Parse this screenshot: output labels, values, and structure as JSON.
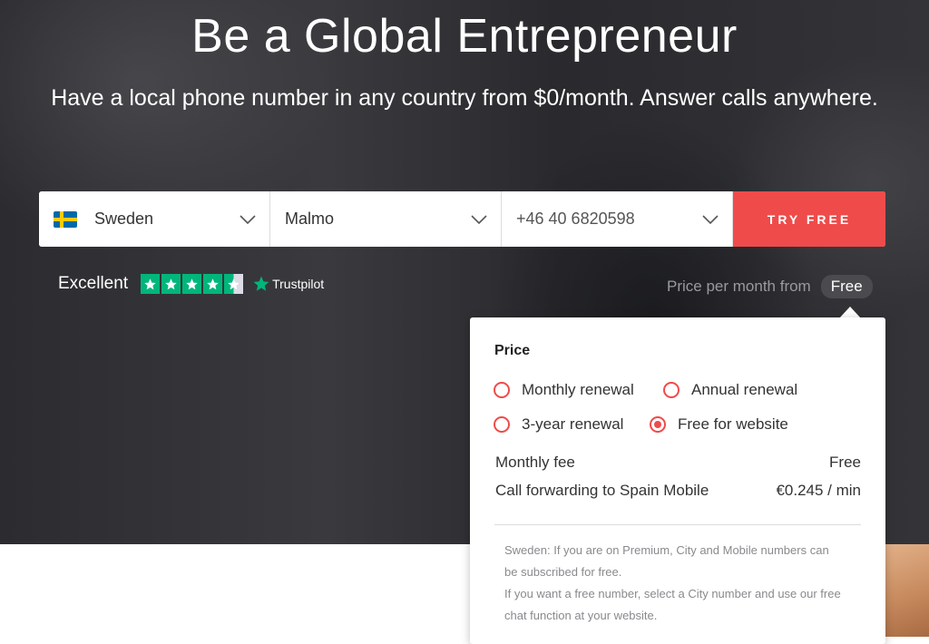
{
  "hero": {
    "title": "Be a Global Entrepreneur",
    "subtitle": "Have a local phone number in any country from $0/month. Answer calls anywhere."
  },
  "search": {
    "country": "Sweden",
    "city": "Malmo",
    "number": "+46 40 6820598",
    "button": "TRY FREE"
  },
  "colors": {
    "accent": "#ef4b4b",
    "trustpilot_green": "#00b67a",
    "hero_bg": "#2f2f33"
  },
  "rating": {
    "label": "Excellent",
    "stars": 4.5,
    "brand": "Trustpilot"
  },
  "price_summary": {
    "label": "Price per month from",
    "value": "Free"
  },
  "popup": {
    "title": "Price",
    "options": [
      {
        "label": "Monthly renewal",
        "selected": false
      },
      {
        "label": "Annual renewal",
        "selected": false
      },
      {
        "label": "3-year renewal",
        "selected": false
      },
      {
        "label": "Free for website",
        "selected": true
      }
    ],
    "fees": [
      {
        "label": "Monthly fee",
        "value": "Free"
      },
      {
        "label": "Call forwarding to Spain Mobile",
        "value": "€0.245 / min"
      }
    ],
    "note_lines": [
      "Sweden: If you are on Premium, City and Mobile numbers can",
      "be subscribed for free.",
      "If you want a free number, select a City number and use our free",
      "chat function at your website."
    ]
  }
}
